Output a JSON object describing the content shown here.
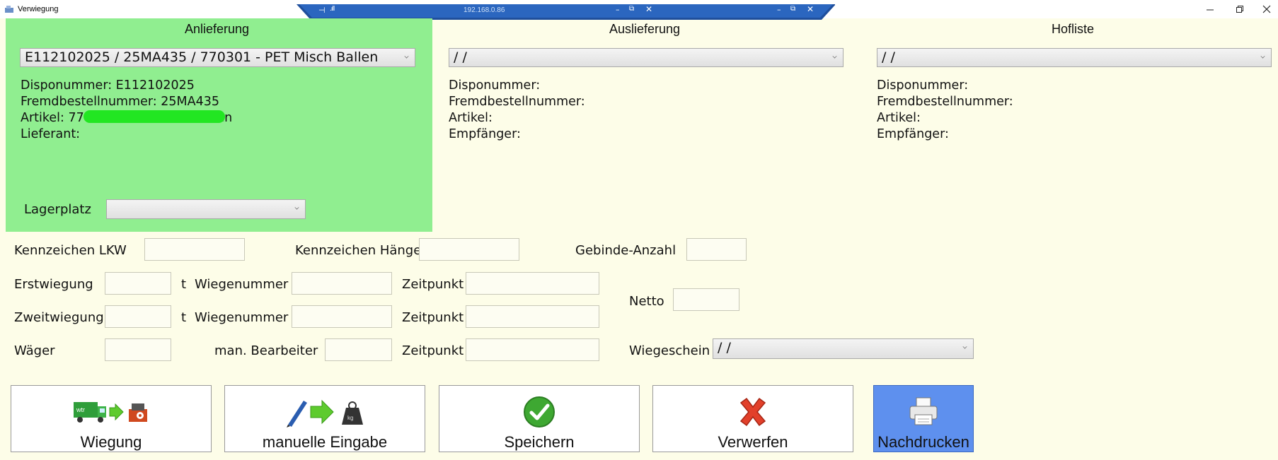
{
  "window": {
    "title": "Verwiegung",
    "remote_address": "192.168.0.86",
    "remote_controls": [
      "–",
      "⧉",
      "✕"
    ]
  },
  "anlieferung": {
    "title": "Anlieferung",
    "selected": "E112102025 / 25MA435 / 770301 - PET Misch Ballen",
    "disponummer": "Disponummer: E112102025",
    "fremdbestellnummer": "Fremdbestellnummer: 25MA435",
    "artikel": "Artikel: 770301 - PET Misch Ballen",
    "lieferant": "Lieferant:",
    "lagerplatz_label": "Lagerplatz",
    "lagerplatz_value": ""
  },
  "auslieferung": {
    "title": "Auslieferung",
    "selected": " /  /",
    "disponummer": "Disponummer:",
    "fremdbestellnummer": "Fremdbestellnummer:",
    "artikel": "Artikel:",
    "empfaenger": "Empfänger:"
  },
  "hofliste": {
    "title": "Hofliste",
    "selected": " /  /",
    "disponummer": "Disponummer:",
    "fremdbestellnummer": "Fremdbestellnummer:",
    "artikel": "Artikel:",
    "empfaenger": "Empfänger:"
  },
  "form": {
    "kennzeichen_lkw": "Kennzeichen LKW",
    "kennzeichen_haenger": "Kennzeichen Hänger",
    "gebinde_anzahl": "Gebinde-Anzahl",
    "erstwiegung": "Erstwiegung",
    "zweitwiegung": "Zweitwiegung",
    "waeger": "Wäger",
    "unit_t": "t",
    "wiegenummer": "Wiegenummer",
    "zeitpunkt": "Zeitpunkt",
    "man_bearbeiter": "man. Bearbeiter",
    "netto": "Netto",
    "wiegeschein": "Wiegeschein",
    "wiegeschein_value": " /  /"
  },
  "buttons": {
    "wiegung": "Wiegung",
    "manuelle_eingabe": "manuelle Eingabe",
    "speichern": "Speichern",
    "verwerfen": "Verwerfen",
    "nachdrucken": "Nachdrucken"
  },
  "truck_logo_text": "wtr",
  "colors": {
    "anlieferung_bg": "#90ee90",
    "page_bg": "#fdfde8",
    "nachdrucken_bg": "#5e90ee",
    "remote_bar": "#1f4f9c"
  }
}
